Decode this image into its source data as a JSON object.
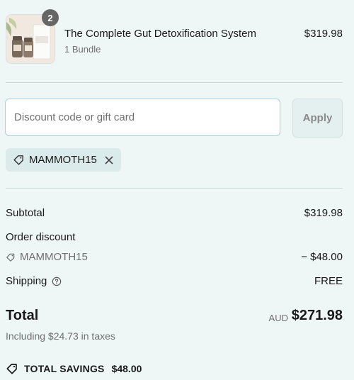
{
  "product": {
    "quantity": "2",
    "name": "The Complete Gut Detoxification System",
    "variant": "1 Bundle",
    "price": "$319.98",
    "thumbnail_icon": "product-bundle-image"
  },
  "discount": {
    "placeholder": "Discount code or gift card",
    "value": "",
    "apply_label": "Apply",
    "applied_code": "MAMMOTH15"
  },
  "summary": {
    "subtotal_label": "Subtotal",
    "subtotal_value": "$319.98",
    "order_discount_label": "Order discount",
    "discount_code": "MAMMOTH15",
    "discount_value": "− $48.00",
    "shipping_label": "Shipping",
    "shipping_value": "FREE",
    "total_label": "Total",
    "currency": "AUD",
    "total_value": "$271.98",
    "tax_note": "Including $24.73 in taxes",
    "savings_label": "TOTAL SAVINGS",
    "savings_value": "$48.00"
  },
  "colors": {
    "background": "#eef6f6",
    "input_border": "#a8d0de",
    "chip_background": "#dbeaea"
  }
}
